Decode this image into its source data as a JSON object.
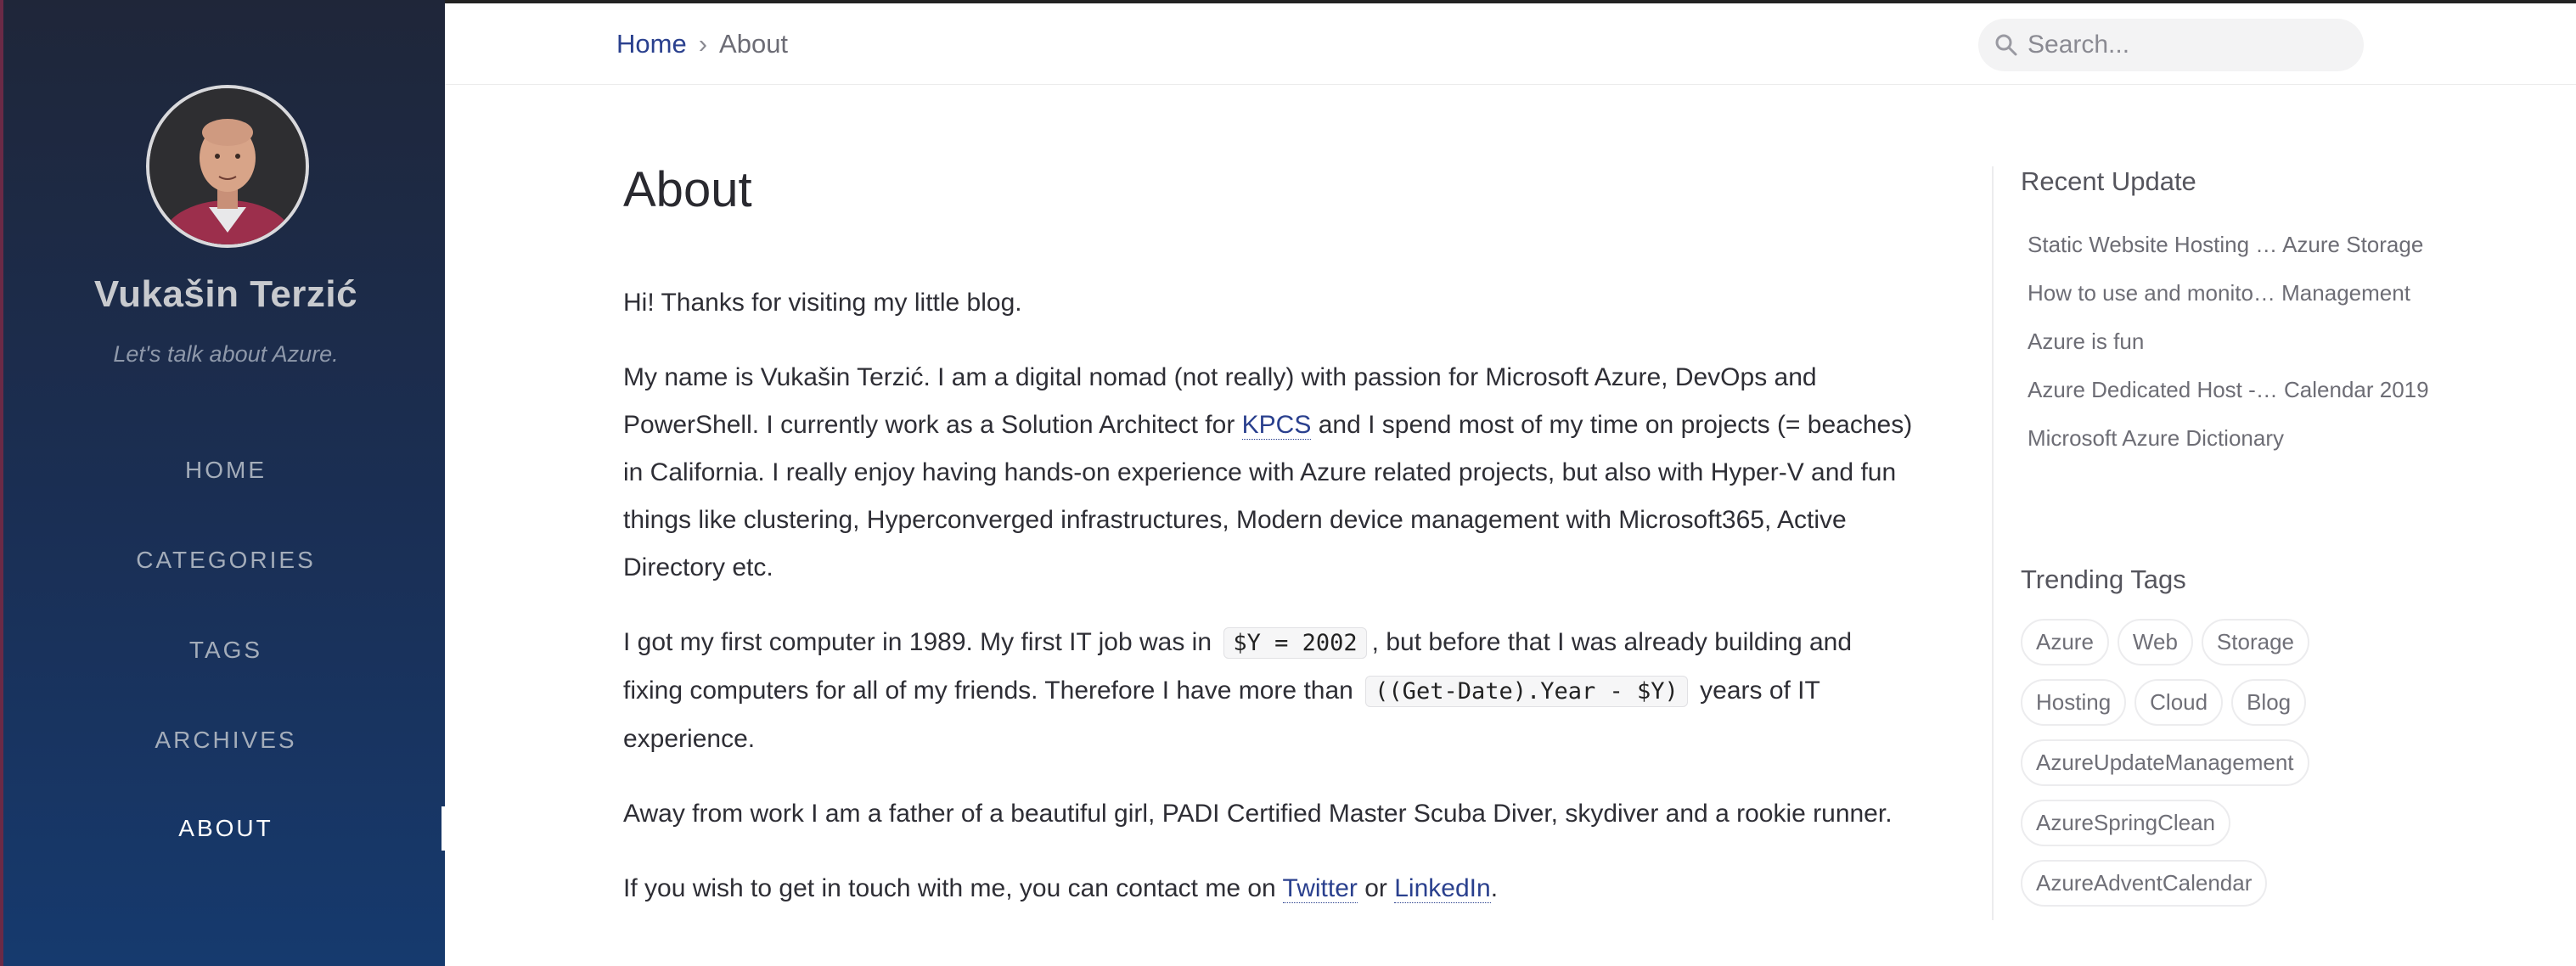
{
  "sidebar": {
    "title": "Vukašin Terzić",
    "subtitle": "Let's talk about Azure.",
    "nav": [
      {
        "label": "HOME"
      },
      {
        "label": "CATEGORIES"
      },
      {
        "label": "TAGS"
      },
      {
        "label": "ARCHIVES"
      },
      {
        "label": "ABOUT",
        "active": true
      }
    ]
  },
  "topbar": {
    "breadcrumb": {
      "home": "Home",
      "separator": "›",
      "current": "About"
    },
    "search": {
      "placeholder": "Search..."
    }
  },
  "main": {
    "title": "About",
    "p1": "Hi! Thanks for visiting my little blog.",
    "p2": {
      "before": "My name is Vukašin Terzić. I am a digital nomad (not really) with passion for Microsoft Azure, DevOps and PowerShell. I currently work as a Solution Architect for ",
      "link": "KPCS",
      "after": " and I spend most of my time on projects (= beaches) in California. I really enjoy having hands-on experience with Azure related projects, but also with Hyper-V and fun things like clustering, Hyperconverged infrastructures, Modern device management with Microsoft365, Active Directory etc."
    },
    "p3": {
      "a": "I got my first computer in 1989. My first IT job was in ",
      "code1": "$Y = 2002",
      "b": ", but before that I was already building and fixing computers for all of my friends. Therefore I have more than ",
      "code2": "((Get-Date).Year - $Y)",
      "c": " years of IT experience."
    },
    "p4": "Away from work I am a father of a beautiful girl, PADI Certified Master Scuba Diver, skydiver and a rookie runner.",
    "p5": {
      "a": "If you wish to get in touch with me, you can contact me on ",
      "twitter": "Twitter",
      "b": " or ",
      "linkedin": "LinkedIn",
      "c": "."
    }
  },
  "panel": {
    "recent_heading": "Recent Update",
    "recent": [
      "Static Website Hosting … Azure Storage",
      "How to use and monito… Management",
      "Azure is fun",
      "Azure Dedicated Host -… Calendar 2019",
      "Microsoft Azure Dictionary"
    ],
    "tags_heading": "Trending Tags",
    "tags": [
      "Azure",
      "Web",
      "Storage",
      "Hosting",
      "Cloud",
      "Blog",
      "AzureUpdateManagement",
      "AzureSpringClean",
      "AzureAdventCalendar"
    ]
  },
  "colors": {
    "sidebar_top": "#1f2639",
    "sidebar_bottom": "#163a6e",
    "link": "#2a408e"
  },
  "icons": {
    "search": "search-icon",
    "avatar": "avatar"
  }
}
